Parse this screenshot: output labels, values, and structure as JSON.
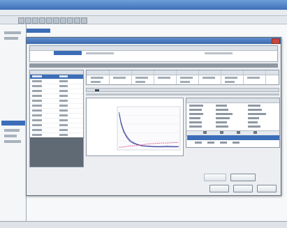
{
  "window": {
    "title": ""
  },
  "dialog": {
    "title": "",
    "header_columns": [
      "",
      "",
      "",
      "",
      "",
      "",
      "",
      ""
    ]
  },
  "info_panel": {
    "header_left": "",
    "header_right": ""
  },
  "buttons": {
    "disabled_label": "",
    "update_label": "",
    "ok_label": "",
    "cancel_label": "",
    "help_label": ""
  },
  "colors": {
    "accent_selection": "#3c6eb8",
    "series_primary": "#7a7fc0",
    "series_secondary": "#e05a8c",
    "series_fit": "#3a3f9a"
  },
  "chart_data": {
    "type": "line",
    "title": "",
    "xlabel": "",
    "ylabel": "",
    "xlim": [
      0,
      10
    ],
    "ylim": [
      0,
      10
    ],
    "series": [
      {
        "x": [
          0.3,
          0.6,
          1.0,
          1.5,
          2.0,
          2.6,
          3.2,
          4.0,
          5.0,
          6.0,
          7.0,
          8.0,
          9.0,
          9.7
        ],
        "values": [
          8.6,
          6.4,
          4.6,
          3.2,
          2.3,
          1.7,
          1.3,
          1.0,
          0.9,
          0.8,
          0.8,
          0.9,
          0.8,
          0.8
        ]
      },
      {
        "x": [
          0.3,
          0.6,
          1.0,
          1.5,
          2.0,
          2.6,
          3.2,
          4.0,
          5.0,
          6.0,
          7.0,
          8.0,
          9.0,
          9.7
        ],
        "values": [
          8.4,
          6.0,
          4.2,
          2.9,
          2.0,
          1.5,
          1.2,
          0.9,
          0.8,
          0.7,
          0.7,
          0.7,
          0.7,
          0.7
        ]
      },
      {
        "x": [
          0.3,
          1.0,
          2.0,
          3.0,
          4.0,
          5.0,
          6.0,
          7.0,
          8.0,
          9.0,
          9.7
        ],
        "values": [
          0.6,
          0.7,
          0.9,
          1.0,
          1.2,
          1.4,
          1.5,
          1.6,
          1.6,
          1.7,
          1.7
        ]
      }
    ]
  }
}
